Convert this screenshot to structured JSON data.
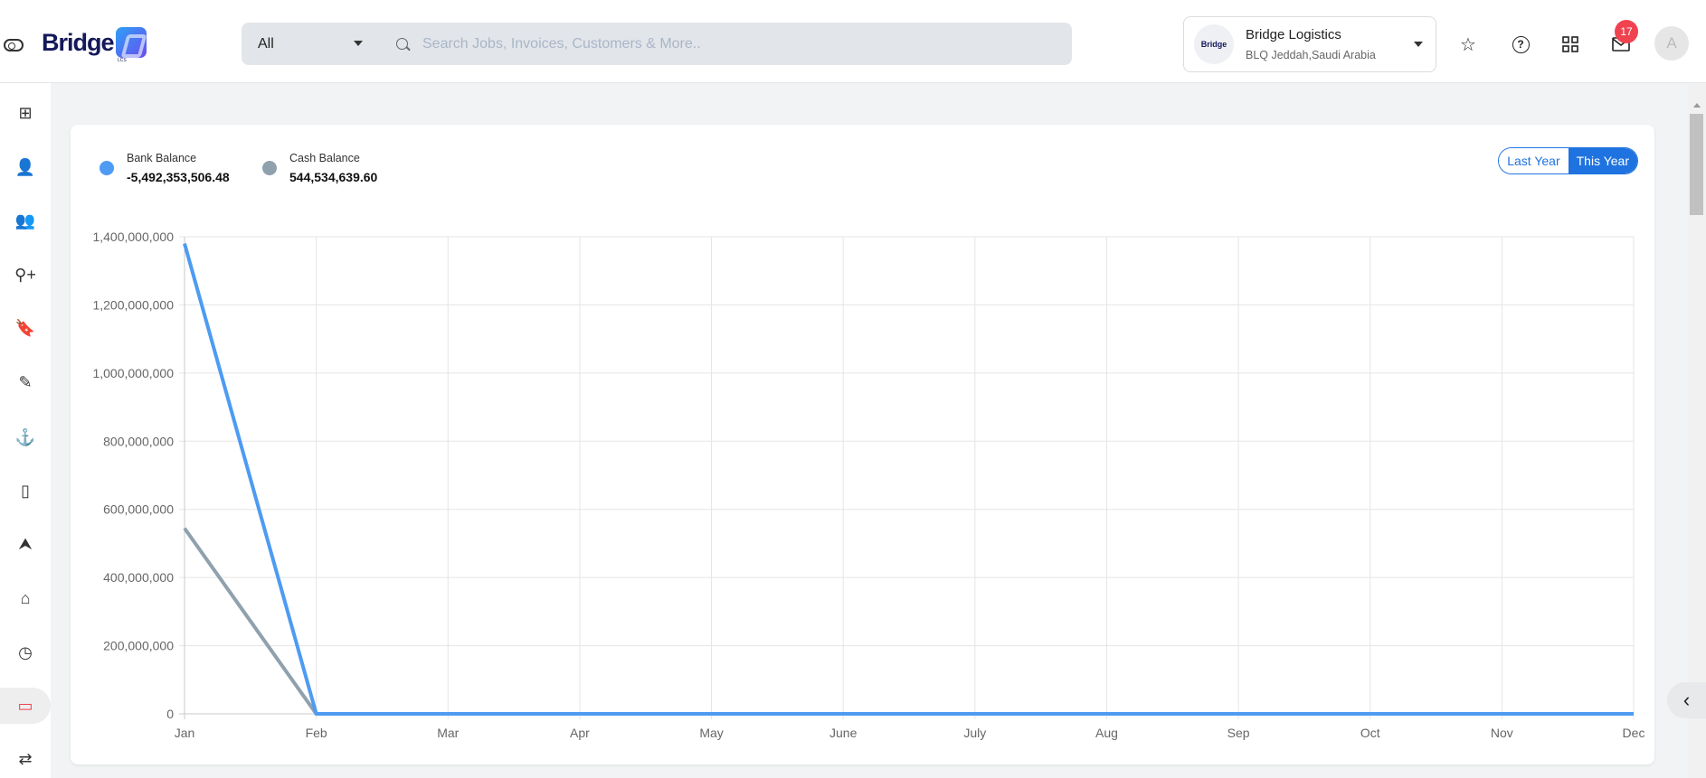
{
  "header": {
    "logo_text": "Bridge",
    "logo_sub": "LCS",
    "search_scope": "All",
    "search_placeholder": "Search Jobs, Invoices, Customers & More..",
    "company": {
      "logo_text": "Bridge",
      "name": "Bridge Logistics",
      "location": "BLQ Jeddah,Saudi Arabia"
    },
    "icons": [
      "star-icon",
      "help-icon",
      "apps-grid-icon",
      "mail-icon"
    ],
    "notification_count": "17",
    "avatar_initial": "A"
  },
  "sidebar": {
    "items": [
      {
        "icon": "dashboard-icon",
        "glyph": "⊞"
      },
      {
        "icon": "user-icon",
        "glyph": "👤"
      },
      {
        "icon": "users-icon",
        "glyph": "👥"
      },
      {
        "icon": "user-add-icon",
        "glyph": "⚲+"
      },
      {
        "icon": "bookmark-icon",
        "glyph": "🔖"
      },
      {
        "icon": "edit-icon",
        "glyph": "✎"
      },
      {
        "icon": "anchor-icon",
        "glyph": "⚓"
      },
      {
        "icon": "bar-chart-icon",
        "glyph": "▯"
      },
      {
        "icon": "navigation-icon",
        "glyph": "⮝"
      },
      {
        "icon": "tag-icon",
        "glyph": "⌂"
      },
      {
        "icon": "clock-icon",
        "glyph": "◷"
      },
      {
        "icon": "credit-card-icon",
        "glyph": "▭",
        "active": true
      },
      {
        "icon": "transfer-icon",
        "glyph": "⇄"
      }
    ]
  },
  "card": {
    "legend": [
      {
        "label": "Bank Balance",
        "value": "-5,492,353,506.48",
        "color": "#4d9bf2"
      },
      {
        "label": "Cash Balance",
        "value": "544,534,639.60",
        "color": "#8fa1ad"
      }
    ],
    "period_toggle": {
      "last_year": "Last Year",
      "this_year": "This Year",
      "selected": "This Year"
    }
  },
  "chart_data": {
    "type": "line",
    "categories": [
      "Jan",
      "Feb",
      "Mar",
      "Apr",
      "May",
      "June",
      "July",
      "Aug",
      "Sep",
      "Oct",
      "Nov",
      "Dec"
    ],
    "series": [
      {
        "name": "Bank Balance",
        "color": "#4d9bf2",
        "values": [
          1380000000,
          0,
          0,
          0,
          0,
          0,
          0,
          0,
          0,
          0,
          0,
          0
        ]
      },
      {
        "name": "Cash Balance",
        "color": "#8fa1ad",
        "values": [
          544534639.6,
          0,
          0,
          0,
          0,
          0,
          0,
          0,
          0,
          0,
          0,
          0
        ]
      }
    ],
    "ylim": [
      0,
      1400000000
    ],
    "yticks": [
      "0",
      "200,000,000",
      "400,000,000",
      "600,000,000",
      "800,000,000",
      "1,000,000,000",
      "1,200,000,000",
      "1,400,000,000"
    ],
    "grid": true
  }
}
